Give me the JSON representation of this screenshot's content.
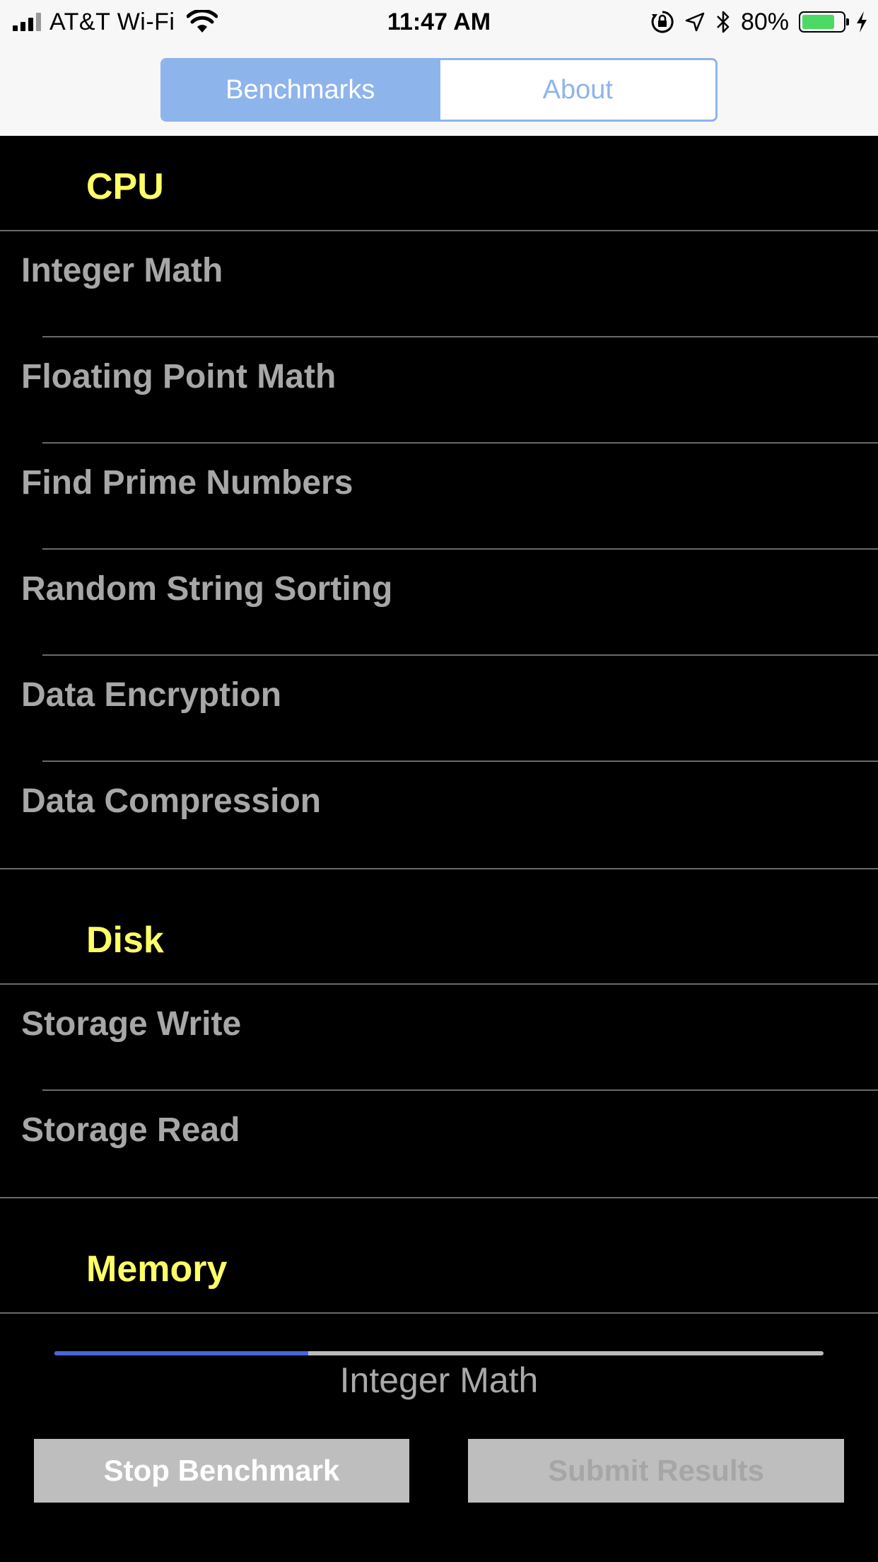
{
  "status_bar": {
    "carrier": "AT&T Wi-Fi",
    "time": "11:47 AM",
    "battery_percent": "80%",
    "battery_level": 0.8,
    "battery_color": "#4cd964",
    "icons": [
      "signal-icon",
      "wifi-icon",
      "orientation-lock-icon",
      "location-icon",
      "bluetooth-icon",
      "battery-icon",
      "charging-icon"
    ]
  },
  "tabs": [
    {
      "label": "Benchmarks",
      "selected": true
    },
    {
      "label": "About",
      "selected": false
    }
  ],
  "accent_color": "#8eb4ec",
  "section_title_color": "#ffff66",
  "sections": [
    {
      "title": "CPU",
      "items": [
        "Integer Math",
        "Floating Point Math",
        "Find Prime Numbers",
        "Random String Sorting",
        "Data Encryption",
        "Data Compression"
      ]
    },
    {
      "title": "Disk",
      "items": [
        "Storage Write",
        "Storage Read"
      ]
    },
    {
      "title": "Memory",
      "items": []
    }
  ],
  "progress": {
    "fraction": 0.33,
    "label": "Integer Math",
    "fill_color": "#4a65d8"
  },
  "buttons": {
    "stop": "Stop Benchmark",
    "submit": "Submit Results"
  }
}
